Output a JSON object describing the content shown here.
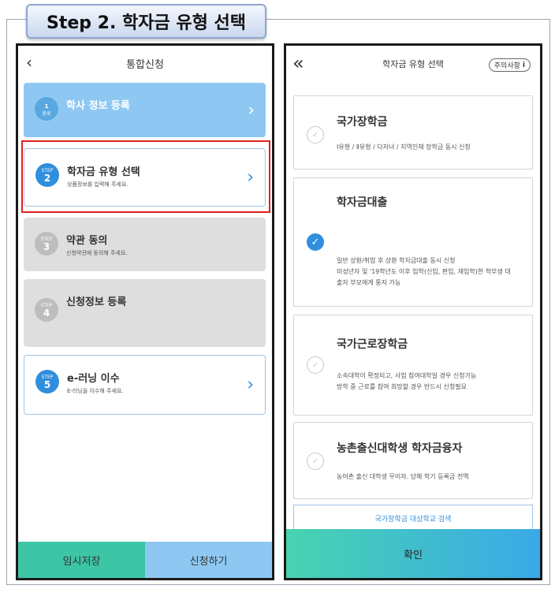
{
  "step_title": "Step 2. 학자금 유형 선택",
  "left": {
    "header_title": "통합신청",
    "back_icon": "‹",
    "steps": [
      {
        "label": "1",
        "badge": "완료",
        "title": "학사 정보 등록",
        "sub": ""
      },
      {
        "label": "STEP",
        "num": "2",
        "title": "학자금 유형 선택",
        "sub": "상품정보를 입력해 주세요."
      },
      {
        "label": "STEP",
        "num": "3",
        "title": "약관 동의",
        "sub": "신청약관에 동의해 주세요."
      },
      {
        "label": "STEP",
        "num": "4",
        "title": "신청정보 등록",
        "sub": ""
      },
      {
        "label": "STEP",
        "num": "5",
        "title": "e-러닝 이수",
        "sub": "E-러닝을 이수해 주세요."
      }
    ],
    "save_label": "임시저장",
    "apply_label": "신청하기"
  },
  "right": {
    "header_title": "학자금 유형 선택",
    "back_icon": "«",
    "notice_label": "주의사항",
    "notice_icon": "i",
    "types": [
      {
        "title": "국가장학금",
        "lines": [
          "Ⅰ유형 / Ⅱ유형 / 다자녀 / 지역인재 장학금 동시 신청"
        ],
        "selected": false
      },
      {
        "title": "학자금대출",
        "lines": [
          "일반 상환/취업 후 상환 학자금대출 동시 신청",
          "미성년자 및 '19학년도 이후 입학(신입, 편입, 재입학)한 학부생 대",
          "출자 부모에게 통지 가능"
        ],
        "selected": true
      },
      {
        "title": "국가근로장학금",
        "lines": [
          "소속대학이 확정되고, 사업 참여대학일 경우 신청가능",
          "방학 중 근로를 참여 희망할 경우 반드시 신청필요"
        ],
        "selected": false
      },
      {
        "title": "농촌출신대학생 학자금융자",
        "lines": [
          "농어촌 출신 대학생 무이자. 당해 학기 등록금 전액"
        ],
        "selected": false
      }
    ],
    "link_label": "국가장학금 대상학교 검색",
    "confirm_label": "확인"
  }
}
